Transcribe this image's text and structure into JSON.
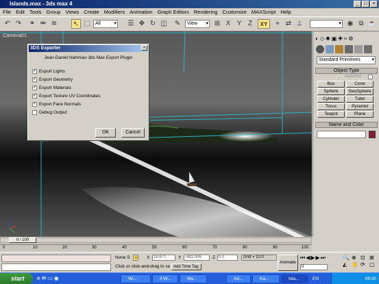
{
  "app": {
    "title": "Islands.max - 3ds max 4"
  },
  "window_buttons": [
    "_",
    "□",
    "×"
  ],
  "menu": [
    "File",
    "Edit",
    "Tools",
    "Group",
    "Views",
    "Create",
    "Modifiers",
    "Animation",
    "Graph Editors",
    "Rendering",
    "Customize",
    "MAXScript",
    "Help"
  ],
  "toolbar": {
    "selection_filter": "All",
    "ref_coord": "View",
    "axis_x": "X",
    "axis_y": "Y",
    "axis_z": "Z",
    "axis_xy": "XY",
    "icons": [
      "undo-icon",
      "redo-icon",
      "link-icon",
      "unlink-icon",
      "bind-icon",
      "select-icon",
      "region-select-icon",
      "move-icon",
      "rotate-icon",
      "scale-icon",
      "manipulate-icon",
      "mirror-icon",
      "align-icon",
      "material-editor-icon",
      "render-icon"
    ]
  },
  "viewport": {
    "label": "Camera01"
  },
  "dialog": {
    "title": "3DS Exporter",
    "heading": "Jean-Daniel Nahmias 3ds Max Export Plugin",
    "options": [
      {
        "label": "Export Lights",
        "checked": true
      },
      {
        "label": "Export Geometry",
        "checked": true
      },
      {
        "label": "Export Materials",
        "checked": true
      },
      {
        "label": "Export Texture UV Coordinates",
        "checked": true
      },
      {
        "label": "Export Face Normals",
        "checked": true
      },
      {
        "label": "Debug Output",
        "checked": false
      }
    ],
    "ok": "OK",
    "cancel": "Cancel"
  },
  "command_panel": {
    "category": "Standard Primitives",
    "object_type_header": "Object Type",
    "autogrid": "AutoGrid",
    "primitives": [
      "Box",
      "Cone",
      "Sphere",
      "GeoSphere",
      "Cylinder",
      "Tube",
      "Torus",
      "Pyramid",
      "Teapot",
      "Plane"
    ],
    "name_color_header": "Name and Color",
    "color": "#8b1a3a"
  },
  "timeline": {
    "frame_counter": "0 / 100",
    "ticks": [
      "0",
      "10",
      "20",
      "30",
      "40",
      "50",
      "60",
      "70",
      "80",
      "90",
      "100"
    ]
  },
  "status": {
    "selection": "None S",
    "x_label": "X",
    "x_value": "18.671",
    "y_label": "Y",
    "y_value": "-481.006",
    "z_label": "Z",
    "z_value": "0.0",
    "grid": "Grid = 10.0",
    "prompt": "Click or click-and-drag to selec",
    "add_time_tag": "Add Time Tag",
    "animate": "Animate",
    "frame": "0"
  },
  "taskbar": {
    "start": "start",
    "tasks": [
      "Wi...",
      "3 W...",
      "Ma...",
      "Ad...",
      "Ka...",
      "Isla..."
    ],
    "lang": "EN",
    "clock": "06:30"
  }
}
